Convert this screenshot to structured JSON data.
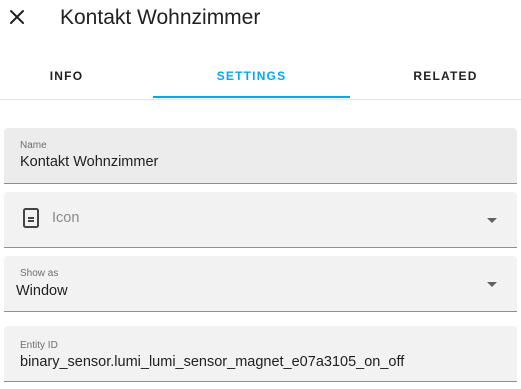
{
  "header": {
    "close_icon": "close-icon",
    "title": "Kontakt Wohnzimmer"
  },
  "tabs": [
    {
      "label": "INFO",
      "active": false
    },
    {
      "label": "SETTINGS",
      "active": true
    },
    {
      "label": "RELATED",
      "active": false
    }
  ],
  "accent_color": "#03a9f4",
  "fields": {
    "name": {
      "label": "Name",
      "value": "Kontakt Wohnzimmer"
    },
    "icon": {
      "icon": "door-sensor-icon",
      "placeholder": "Icon"
    },
    "show_as": {
      "label": "Show as",
      "value": "Window"
    },
    "entity_id": {
      "label": "Entity ID",
      "value": "binary_sensor.lumi_lumi_sensor_magnet_e07a3105_on_off"
    }
  }
}
